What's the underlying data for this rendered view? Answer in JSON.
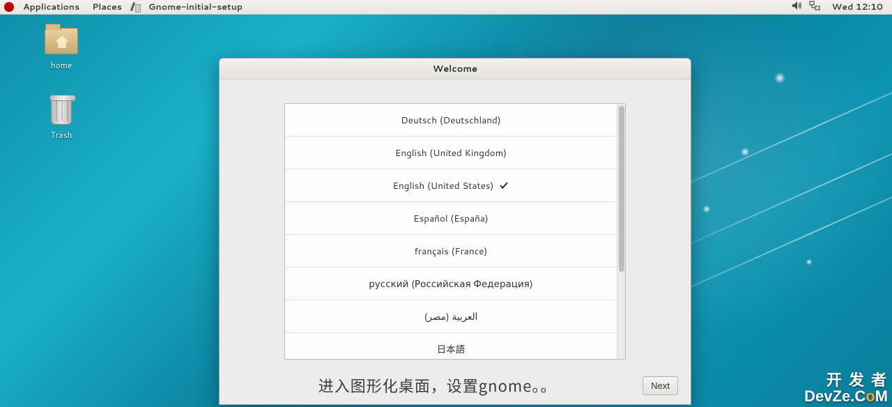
{
  "topbar": {
    "applications": "Applications",
    "places": "Places",
    "app_name": "Gnome-initial-setup",
    "clock": "Wed 12:10"
  },
  "desktop": {
    "home_label": "home",
    "trash_label": "Trash"
  },
  "dialog": {
    "title": "Welcome",
    "languages": [
      {
        "label": "Deutsch (Deutschland)",
        "selected": false
      },
      {
        "label": "English (United Kingdom)",
        "selected": false
      },
      {
        "label": "English (United States)",
        "selected": true
      },
      {
        "label": "Español (España)",
        "selected": false
      },
      {
        "label": "français (France)",
        "selected": false
      },
      {
        "label": "русский (Российская Федерация)",
        "selected": false
      },
      {
        "label": "العربية (مصر)",
        "selected": false
      },
      {
        "label": "日本語",
        "selected": false
      }
    ],
    "footer_note": "进入图形化桌面，设置gnome。。",
    "next_label": "Next"
  },
  "watermark": {
    "line1": "开 发 者",
    "line2_a": "DevZe.C",
    "line2_b": "o",
    "line2_c": "M"
  }
}
